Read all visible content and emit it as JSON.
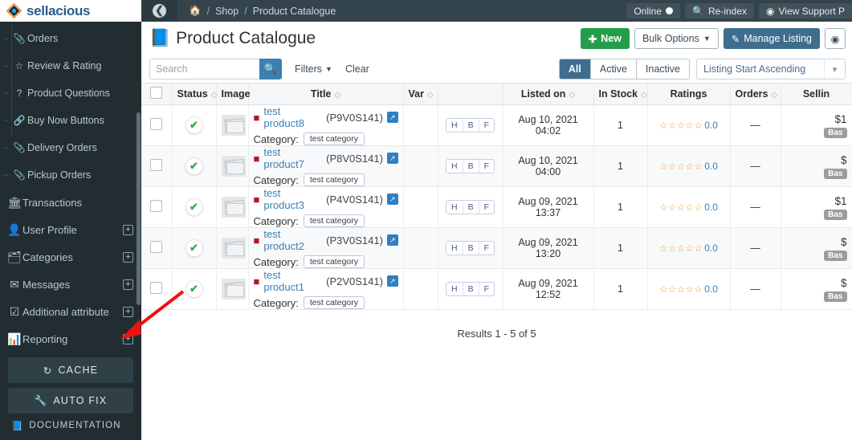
{
  "brand": {
    "name": "sellacious"
  },
  "sidebar": {
    "items": [
      {
        "label": "Orders",
        "icon": "paperclip-icon",
        "expand": false,
        "sub": true
      },
      {
        "label": "Review & Rating",
        "icon": "star-icon",
        "expand": false,
        "sub": true
      },
      {
        "label": "Product Questions",
        "icon": "question-icon",
        "expand": false,
        "sub": true
      },
      {
        "label": "Buy Now Buttons",
        "icon": "link-icon",
        "expand": false,
        "sub": true
      },
      {
        "label": "Delivery Orders",
        "icon": "paperclip-icon",
        "expand": false,
        "sub": true
      },
      {
        "label": "Pickup Orders",
        "icon": "paperclip-icon",
        "expand": false,
        "sub": true
      },
      {
        "label": "Transactions",
        "icon": "bank-icon",
        "expand": false,
        "sub": false
      },
      {
        "label": "User Profile",
        "icon": "user-icon",
        "expand": true,
        "sub": false
      },
      {
        "label": "Categories",
        "icon": "sitemap-icon",
        "expand": true,
        "sub": false
      },
      {
        "label": "Messages",
        "icon": "envelope-icon",
        "expand": true,
        "sub": false
      },
      {
        "label": "Additional attribute",
        "icon": "checkbox-icon",
        "expand": true,
        "sub": false
      },
      {
        "label": "Reporting",
        "icon": "bar-chart-icon",
        "expand": true,
        "sub": false
      }
    ],
    "cache_button": "CACHE",
    "autofix_button": "AUTO FIX",
    "documentation": "DOCUMENTATION"
  },
  "topbar": {
    "back_icon": "back-arrow-icon",
    "breadcrumb": {
      "home": "home-icon",
      "sep": "/",
      "shop": "Shop",
      "current": "Product Catalogue"
    },
    "online_label": "Online",
    "reindex_label": "Re-index",
    "support_label": "View Support P"
  },
  "page": {
    "title": "Product Catalogue",
    "title_icon": "book-icon",
    "buttons": {
      "new": "New",
      "bulk_options": "Bulk Options",
      "manage_listing": "Manage Listing",
      "extra_icon": "circle-icon"
    }
  },
  "filters": {
    "search_placeholder": "Search",
    "search_value": "",
    "search_icon": "search-icon",
    "filters_label": "Filters",
    "clear_label": "Clear",
    "tabs": [
      "All",
      "Active",
      "Inactive"
    ],
    "active_tab": "All",
    "sort_value": "Listing Start Ascending"
  },
  "table": {
    "headers": [
      {
        "label": "",
        "sortable": false
      },
      {
        "label": "Status",
        "sortable": true
      },
      {
        "label": "Image",
        "sortable": false
      },
      {
        "label": "Title",
        "sortable": true
      },
      {
        "label": "Var",
        "sortable": true
      },
      {
        "label": "",
        "sortable": false
      },
      {
        "label": "Listed on",
        "sortable": true
      },
      {
        "label": "In Stock",
        "sortable": true
      },
      {
        "label": "Ratings",
        "sortable": false
      },
      {
        "label": "Orders",
        "sortable": true
      },
      {
        "label": "Sellin",
        "sortable": false
      }
    ],
    "rows": [
      {
        "status": "active",
        "title": "test product8",
        "code": "(P9V0S141)",
        "category_label": "Category:",
        "category": "test category",
        "hbf": [
          "H",
          "B",
          "F"
        ],
        "listed_on": "Aug 10, 2021 04:02",
        "in_stock": "1",
        "rating": "0.0",
        "orders": "—",
        "price": "$1",
        "price_badge": "Bas"
      },
      {
        "status": "active",
        "title": "test product7",
        "code": "(P8V0S141)",
        "category_label": "Category:",
        "category": "test category",
        "hbf": [
          "H",
          "B",
          "F"
        ],
        "listed_on": "Aug 10, 2021 04:00",
        "in_stock": "1",
        "rating": "0.0",
        "orders": "—",
        "price": "$",
        "price_badge": "Bas"
      },
      {
        "status": "active",
        "title": "test product3",
        "code": "(P4V0S141)",
        "category_label": "Category:",
        "category": "test category",
        "hbf": [
          "H",
          "B",
          "F"
        ],
        "listed_on": "Aug 09, 2021 13:37",
        "in_stock": "1",
        "rating": "0.0",
        "orders": "—",
        "price": "$1",
        "price_badge": "Bas"
      },
      {
        "status": "active",
        "title": "test product2",
        "code": "(P3V0S141)",
        "category_label": "Category:",
        "category": "test category",
        "hbf": [
          "H",
          "B",
          "F"
        ],
        "listed_on": "Aug 09, 2021 13:20",
        "in_stock": "1",
        "rating": "0.0",
        "orders": "—",
        "price": "$",
        "price_badge": "Bas"
      },
      {
        "status": "active",
        "title": "test product1",
        "code": "(P2V0S141)",
        "category_label": "Category:",
        "category": "test category",
        "hbf": [
          "H",
          "B",
          "F"
        ],
        "listed_on": "Aug 09, 2021 12:52",
        "in_stock": "1",
        "rating": "0.0",
        "orders": "—",
        "price": "$",
        "price_badge": "Bas"
      }
    ],
    "results": "Results 1 - 5 of 5"
  },
  "annotation": {
    "arrow_color": "#ee1111"
  },
  "colors": {
    "sidebar_bg": "#222d32",
    "topbar_bg": "#34444c",
    "accent_blue": "#3f6d8e",
    "green": "#249d4b",
    "star": "#e8a33d"
  }
}
